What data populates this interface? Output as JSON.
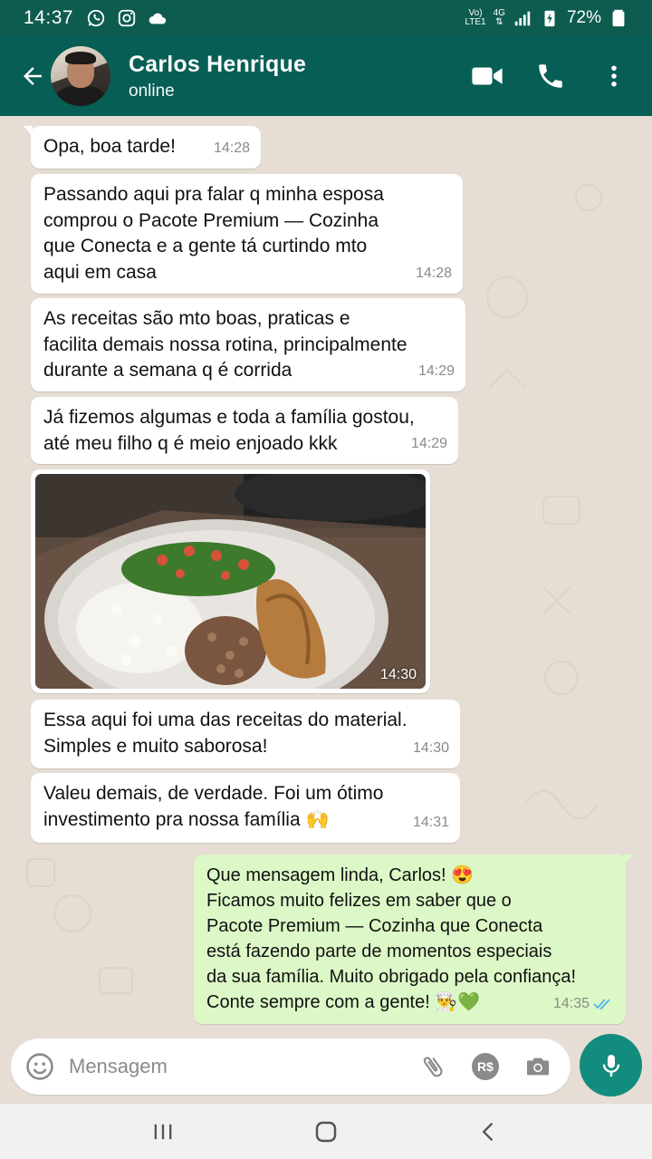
{
  "status_bar": {
    "time": "14:37",
    "volte_top": "Vo)",
    "volte_bottom": "LTE1",
    "network": "4G",
    "battery": "72%"
  },
  "header": {
    "contact_name": "Carlos Henrique",
    "contact_status": "online"
  },
  "messages": [
    {
      "direction": "in",
      "lines": [
        "Opa, boa tarde!"
      ],
      "time": "14:28"
    },
    {
      "direction": "in",
      "lines": [
        "Passando aqui pra falar q minha esposa",
        "comprou o Pacote Premium — Cozinha",
        "que Conecta e a gente tá curtindo mto",
        "aqui em casa"
      ],
      "time": "14:28"
    },
    {
      "direction": "in",
      "lines": [
        "As receitas são mto boas, praticas e",
        "facilita demais nossa rotina, principalmente",
        "durante a semana q é corrida"
      ],
      "time": "14:29"
    },
    {
      "direction": "in",
      "lines": [
        "Já fizemos algumas e toda a família gostou,",
        "até meu filho q é meio enjoado kkk"
      ],
      "time": "14:29"
    },
    {
      "direction": "in",
      "type": "image",
      "alt": "plate-with-rice-beans-salad-chicken",
      "time": "14:30"
    },
    {
      "direction": "in",
      "lines": [
        "Essa aqui foi uma das receitas do material.",
        "Simples e muito saborosa!"
      ],
      "time": "14:30"
    },
    {
      "direction": "in",
      "lines": [
        "Valeu demais, de verdade. Foi um ótimo",
        "investimento pra nossa família 🙌"
      ],
      "time": "14:31"
    },
    {
      "direction": "out",
      "lines": [
        "Que mensagem linda, Carlos! 😍",
        "Ficamos muito felizes em saber que o",
        "Pacote Premium — Cozinha que Conecta",
        "está fazendo parte de momentos especiais",
        "da sua família. Muito obrigado pela confiança!",
        "Conte sempre com a gente! 👨‍🍳💚"
      ],
      "time": "14:35",
      "read": true
    }
  ],
  "composer": {
    "placeholder": "Mensagem",
    "payment_label": "R$"
  },
  "colors": {
    "header": "#075e54",
    "status_bar": "#0d5c4f",
    "outgoing_bubble": "#dcf8c6",
    "accent": "#128c7e",
    "read_ticks": "#4fb6ec"
  },
  "icons": [
    "back-arrow-icon",
    "video-call-icon",
    "phone-icon",
    "more-vert-icon",
    "emoji-icon",
    "attach-icon",
    "payment-icon",
    "camera-icon",
    "mic-icon",
    "recents-icon",
    "home-icon",
    "nav-back-icon",
    "whatsapp-icon",
    "instagram-icon",
    "cloud-icon",
    "signal-icon",
    "battery-icon"
  ]
}
